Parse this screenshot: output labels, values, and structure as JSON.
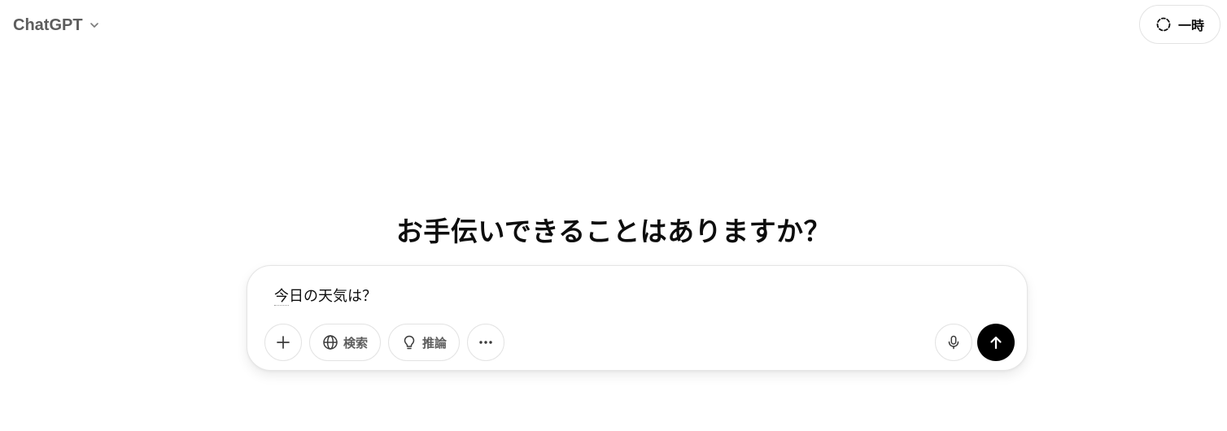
{
  "header": {
    "model_name": "ChatGPT",
    "model_chevron_icon": "chevron-down-icon",
    "temporary_label": "一時",
    "temporary_icon": "dashed-circle-icon"
  },
  "main": {
    "heading": "お手伝いできることはありますか？"
  },
  "composer": {
    "input_first_char": "今",
    "input_rest": "日の天気は？",
    "tools": {
      "attach_icon": "plus-icon",
      "search_label": "検索",
      "search_icon": "globe-icon",
      "reason_label": "推論",
      "reason_icon": "lightbulb-icon",
      "more_icon": "ellipsis-icon",
      "voice_icon": "microphone-icon",
      "send_icon": "arrow-up-icon"
    },
    "colors": {
      "send_bg": "#000000",
      "border": "#e5e5e5",
      "muted_text": "#5d5d5d"
    }
  }
}
